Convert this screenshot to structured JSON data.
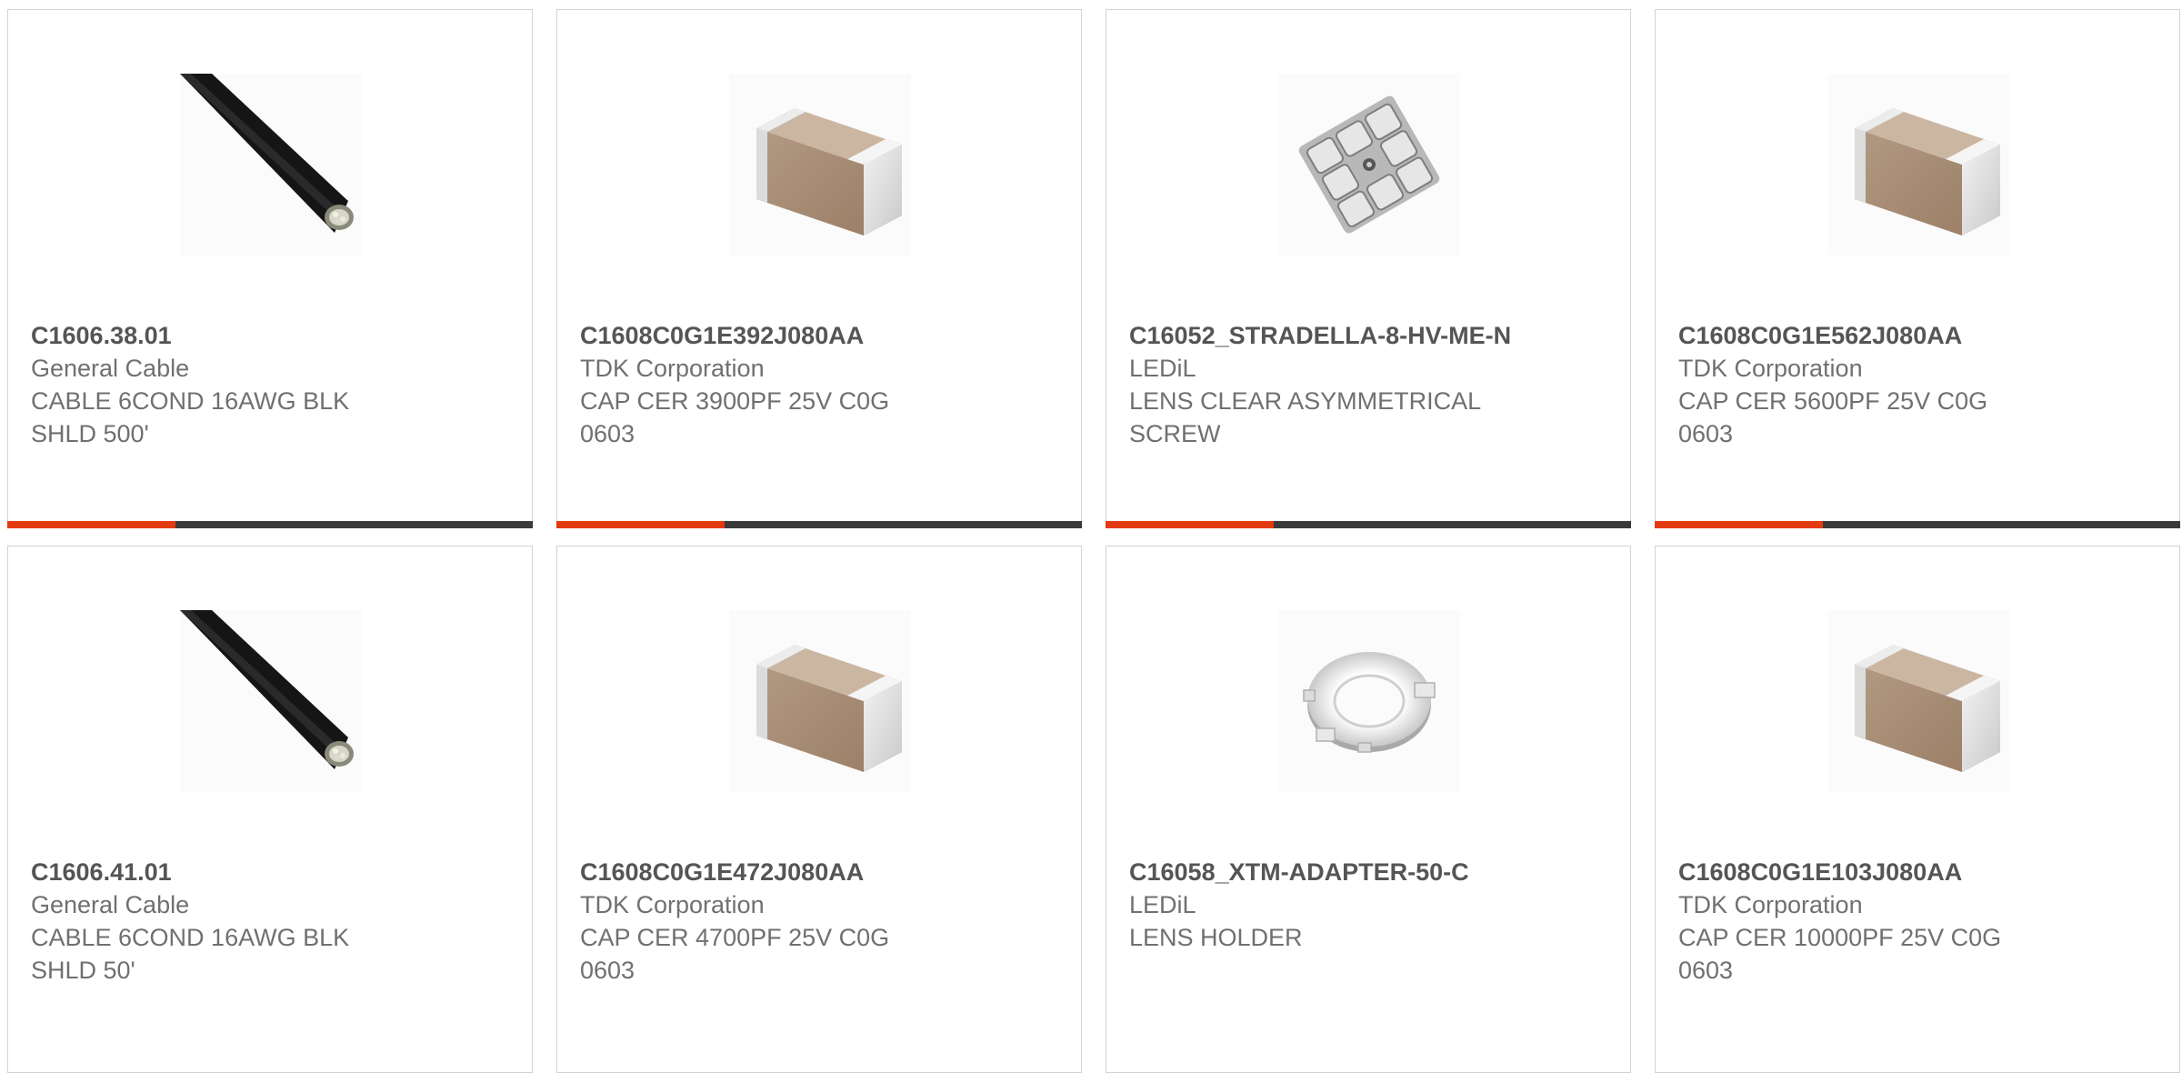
{
  "products": [
    {
      "part_number": "C1606.38.01",
      "manufacturer": "General Cable",
      "description": "CABLE 6COND 16AWG BLK SHLD 500'",
      "image_icon": "black-cable-image",
      "progress_fraction": 0.32
    },
    {
      "part_number": "C1608C0G1E392J080AA",
      "manufacturer": "TDK Corporation",
      "description": "CAP CER 3900PF 25V C0G 0603",
      "image_icon": "ceramic-capacitor-image",
      "progress_fraction": 0.32
    },
    {
      "part_number": "C16052_STRADELLA-8-HV-ME-N",
      "manufacturer": "LEDiL",
      "description": "LENS CLEAR ASYMMETRICAL SCREW",
      "image_icon": "lens-array-image",
      "progress_fraction": 0.32
    },
    {
      "part_number": "C1608C0G1E562J080AA",
      "manufacturer": "TDK Corporation",
      "description": "CAP CER 5600PF 25V C0G 0603",
      "image_icon": "ceramic-capacitor-image",
      "progress_fraction": 0.32
    },
    {
      "part_number": "C1606.41.01",
      "manufacturer": "General Cable",
      "description": "CABLE 6COND 16AWG BLK SHLD 50'",
      "image_icon": "black-cable-image"
    },
    {
      "part_number": "C1608C0G1E472J080AA",
      "manufacturer": "TDK Corporation",
      "description": "CAP CER 4700PF 25V C0G 0603",
      "image_icon": "ceramic-capacitor-image"
    },
    {
      "part_number": "C16058_XTM-ADAPTER-50-C",
      "manufacturer": "LEDiL",
      "description": "LENS HOLDER",
      "image_icon": "lens-holder-ring-image"
    },
    {
      "part_number": "C1608C0G1E103J080AA",
      "manufacturer": "TDK Corporation",
      "description": "CAP CER 10000PF 25V C0G 0603",
      "image_icon": "ceramic-capacitor-image"
    }
  ],
  "colors": {
    "accent": "#e43a12",
    "bar_track": "#3a3a3a",
    "card_border": "#d3d3d3",
    "part_number_text": "#555555",
    "body_text": "#707070"
  }
}
